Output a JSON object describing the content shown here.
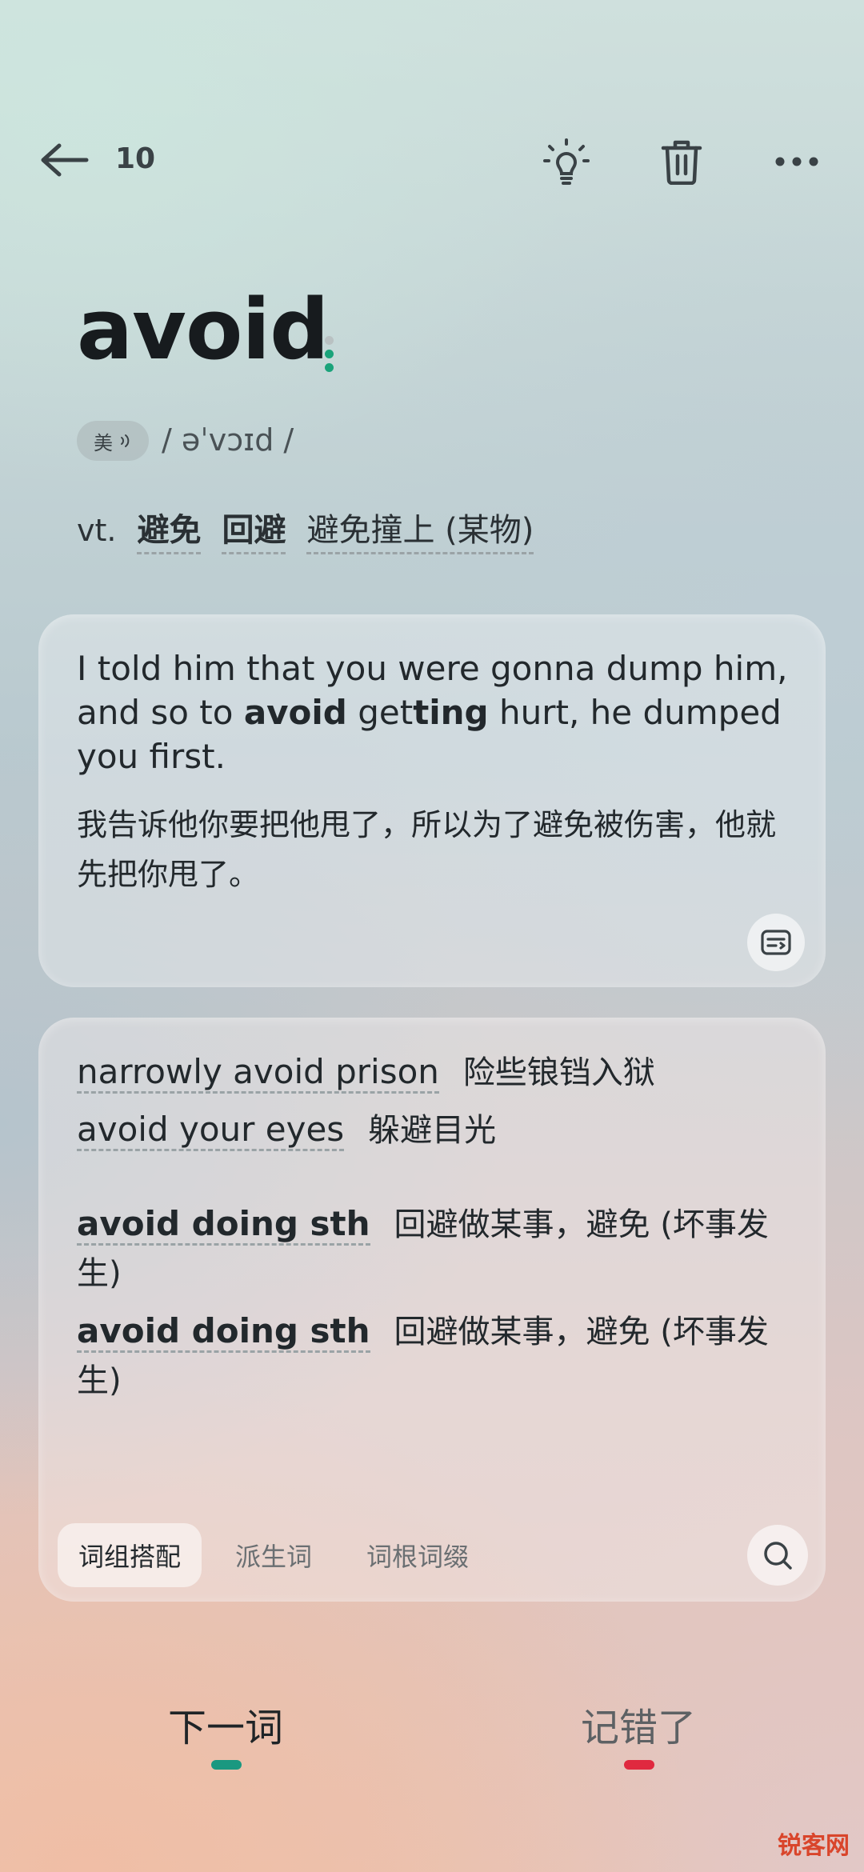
{
  "header": {
    "count": "10"
  },
  "word": {
    "text": "avoid",
    "region": "美",
    "phonetic": "/ əˈvɔɪd /",
    "pos": "vt.",
    "definitions": [
      "避免",
      "回避",
      "避免撞上 (某物)"
    ]
  },
  "example": {
    "en_parts": [
      "I told him that you were gonna dump him, and so to ",
      "avoid",
      " get",
      "ting",
      " hurt, he dumped you first."
    ],
    "zh": "我告诉他你要把他甩了，所以为了避免被伤害，他就先把你甩了。"
  },
  "phrases": [
    {
      "en": "narrowly avoid prison",
      "zh": "险些锒铛入狱"
    },
    {
      "en": "avoid your eyes",
      "zh": "躲避目光"
    },
    {
      "en": "avoid doing sth",
      "zh": "回避做某事，避免 (坏事发生)"
    },
    {
      "en": "avoid doing sth",
      "zh": "回避做某事，避免 (坏事发生)"
    }
  ],
  "tabs": [
    "词组搭配",
    "派生词",
    "词根词缀"
  ],
  "bottom": {
    "next": "下一词",
    "wrong": "记错了"
  },
  "watermark": "锐客网",
  "colors": {
    "accent_green": "#1aa37a",
    "accent_red": "#e0293f",
    "dot_gray": "#b9c1c2"
  }
}
